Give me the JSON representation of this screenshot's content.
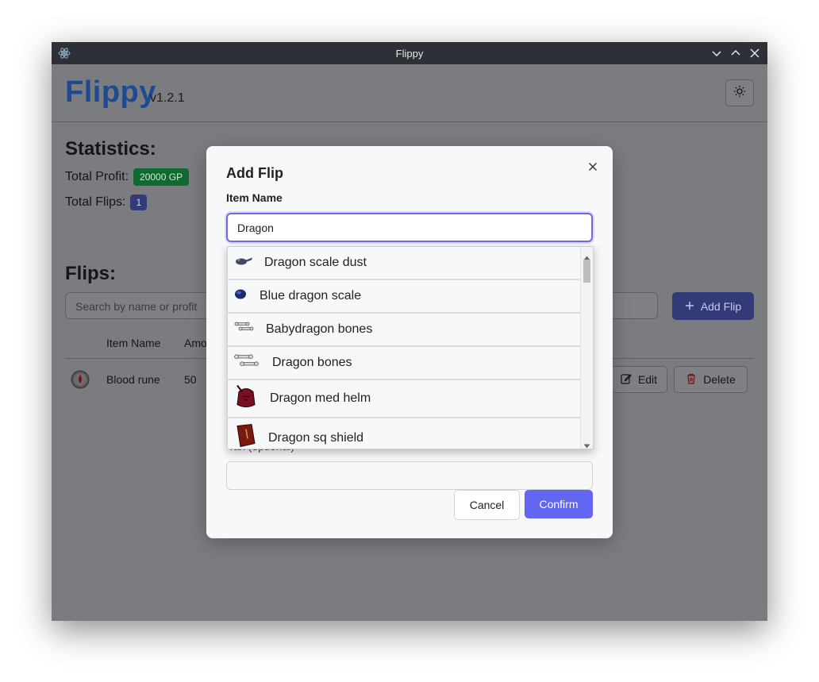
{
  "window": {
    "title": "Flippy"
  },
  "header": {
    "brand": "Flippy",
    "version": "v1.2.1"
  },
  "statistics": {
    "heading": "Statistics:",
    "total_profit_label": "Total Profit:",
    "total_profit_value": "20000 GP",
    "total_flips_label": "Total Flips:",
    "total_flips_value": "1"
  },
  "flips": {
    "heading": "Flips:",
    "search_placeholder": "Search by name or profit",
    "add_button": "Add Flip",
    "columns": [
      "Item Name",
      "Amo"
    ],
    "rows": [
      {
        "name": "Blood rune",
        "amount": "50",
        "edit": "Edit",
        "delete": "Delete"
      }
    ]
  },
  "modal": {
    "title": "Add Flip",
    "item_name_label": "Item Name",
    "item_name_value": "Dragon",
    "tax_label": "Tax (optional)",
    "tax_value": "",
    "cancel": "Cancel",
    "confirm": "Confirm",
    "suggestions": [
      "Dragon scale dust",
      "Blue dragon scale",
      "Babydragon bones",
      "Dragon bones",
      "Dragon med helm",
      "Dragon sq shield"
    ]
  },
  "colors": {
    "brand": "#1f4a92",
    "profit_badge": "#0e6a30",
    "flips_badge": "#333a78",
    "confirm": "#6366f1",
    "focus_ring": "#6f67e6"
  },
  "icons": {
    "app": "electron-icon",
    "theme": "sun-icon",
    "close": "close-icon"
  }
}
